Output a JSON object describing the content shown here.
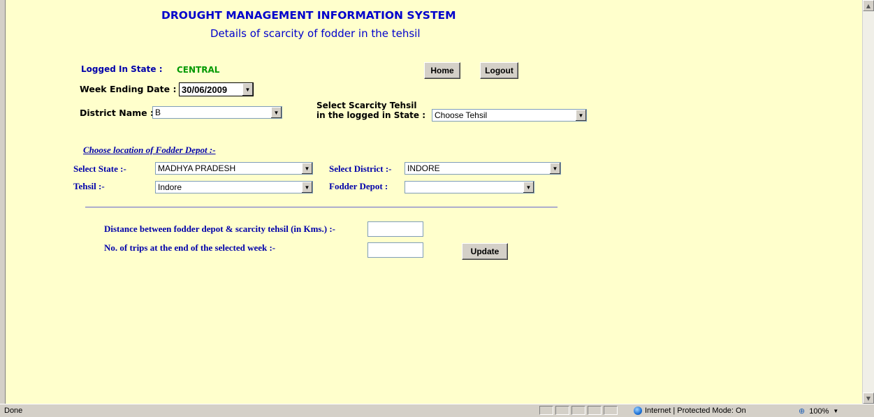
{
  "header": {
    "title": "DROUGHT MANAGEMENT INFORMATION SYSTEM",
    "subtitle": "Details of scarcity of fodder in the tehsil"
  },
  "login": {
    "state_label": "Logged In State :",
    "state_value": "CENTRAL"
  },
  "nav": {
    "home_label": "Home",
    "logout_label": "Logout"
  },
  "filters": {
    "week_ending_label": "Week Ending Date :",
    "week_ending_value": "30/06/2009",
    "district_label": "District Name :",
    "district_value": "B",
    "scarcity_tehsil_label_line1": "Select Scarcity Tehsil",
    "scarcity_tehsil_label_line2": "in the logged in State :",
    "scarcity_tehsil_value": "Choose Tehsil"
  },
  "depot": {
    "section_title": "Choose location of Fodder Depot :-",
    "state_label": "Select State :-",
    "state_value": "MADHYA PRADESH",
    "district_label": "Select District :-",
    "district_value": "INDORE",
    "tehsil_label": "Tehsil :-",
    "tehsil_value": "Indore",
    "fodder_depot_label": "Fodder Depot :",
    "fodder_depot_value": ""
  },
  "form": {
    "distance_label": "Distance between fodder depot & scarcity tehsil (in Kms.) :-",
    "distance_value": "",
    "trips_label": "No. of trips at the end of the selected week :-",
    "trips_value": "",
    "update_label": "Update"
  },
  "statusbar": {
    "left_text": "Done",
    "zone_text": "Internet | Protected Mode: On",
    "zoom_text": "100%"
  },
  "colors": {
    "page_background": "#ffffcc",
    "title_blue": "#0000cc",
    "state_green": "#009900"
  }
}
